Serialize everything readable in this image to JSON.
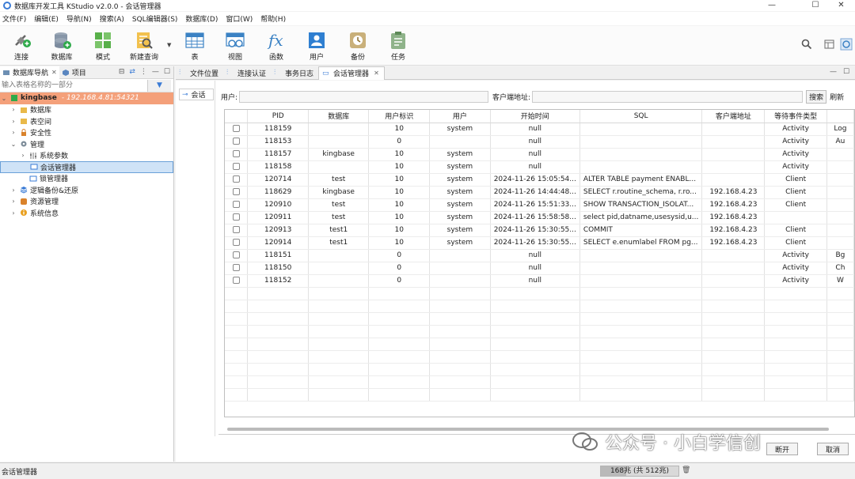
{
  "window": {
    "title": "数据库开发工具 KStudio v2.0.0 - 会话管理器",
    "controls": {
      "minimize": "—",
      "maximize": "☐",
      "close": "✕"
    }
  },
  "menu": [
    "文件(F)",
    "编辑(E)",
    "导航(N)",
    "搜索(A)",
    "SQL编辑器(S)",
    "数据库(D)",
    "窗口(W)",
    "帮助(H)"
  ],
  "toolbar": {
    "connect": "连接",
    "database": "数据库",
    "schema": "模式",
    "new_query": "新建查询",
    "table": "表",
    "view": "视图",
    "function": "函数",
    "user": "用户",
    "backup": "备份",
    "task": "任务"
  },
  "left": {
    "tabs": [
      {
        "label": "数据库导航"
      },
      {
        "label": "项目"
      }
    ],
    "filter_placeholder": "输入表格名称的一部分",
    "connection": {
      "name": "kingbase",
      "host": "- 192.168.4.81:54321"
    },
    "tree": [
      "数据库",
      "表空间",
      "安全性",
      "管理",
      "系统参数",
      "会话管理器",
      "锁管理器",
      "逻辑备份&还原",
      "资源管理",
      "系统信息"
    ]
  },
  "editor_tabs": [
    "文件位置",
    "连接认证",
    "事务日志",
    "会话管理器"
  ],
  "content": {
    "subtab": "会话",
    "user_label": "用户:",
    "client_label": "客户端地址:",
    "search_button": "搜索",
    "refresh_button": "刷新",
    "disconnect_button": "断开",
    "cancel_button": "取消"
  },
  "sessions": {
    "columns": [
      "PID",
      "数据库",
      "用户标识",
      "用户",
      "开始时间",
      "SQL",
      "客户端地址",
      "等待事件类型",
      ""
    ],
    "rows": [
      [
        "118159",
        "",
        "10",
        "system",
        "null",
        "",
        "",
        "Activity",
        "Log"
      ],
      [
        "118153",
        "",
        "0",
        "",
        "null",
        "",
        "",
        "Activity",
        "Au"
      ],
      [
        "118157",
        "kingbase",
        "10",
        "system",
        "null",
        "",
        "",
        "Activity",
        ""
      ],
      [
        "118158",
        "",
        "10",
        "system",
        "null",
        "",
        "",
        "Activity",
        ""
      ],
      [
        "120714",
        "test",
        "10",
        "system",
        "2024-11-26 15:05:54...",
        "ALTER TABLE payment ENABL...",
        "",
        "Client",
        ""
      ],
      [
        "118629",
        "kingbase",
        "10",
        "system",
        "2024-11-26 14:44:48...",
        "SELECT r.routine_schema, r.ro...",
        "192.168.4.23",
        "Client",
        ""
      ],
      [
        "120910",
        "test",
        "10",
        "system",
        "2024-11-26 15:51:33...",
        "SHOW TRANSACTION_ISOLAT...",
        "192.168.4.23",
        "Client",
        ""
      ],
      [
        "120911",
        "test",
        "10",
        "system",
        "2024-11-26 15:58:58...",
        "select pid,datname,usesysid,u...",
        "192.168.4.23",
        "",
        ""
      ],
      [
        "120913",
        "test1",
        "10",
        "system",
        "2024-11-26 15:30:55...",
        "COMMIT",
        "192.168.4.23",
        "Client",
        ""
      ],
      [
        "120914",
        "test1",
        "10",
        "system",
        "2024-11-26 15:30:55...",
        "SELECT e.enumlabel FROM pg...",
        "192.168.4.23",
        "Client",
        ""
      ],
      [
        "118151",
        "",
        "0",
        "",
        "null",
        "",
        "",
        "Activity",
        "Bg"
      ],
      [
        "118150",
        "",
        "0",
        "",
        "null",
        "",
        "",
        "Activity",
        "Ch"
      ],
      [
        "118152",
        "",
        "0",
        "",
        "null",
        "",
        "",
        "Activity",
        "W"
      ]
    ]
  },
  "watermark": "公众号 · 小白学信创",
  "status": {
    "left": "会话管理器",
    "memory": "168兆 (共 512兆)",
    "memory_fraction": 0.33
  }
}
